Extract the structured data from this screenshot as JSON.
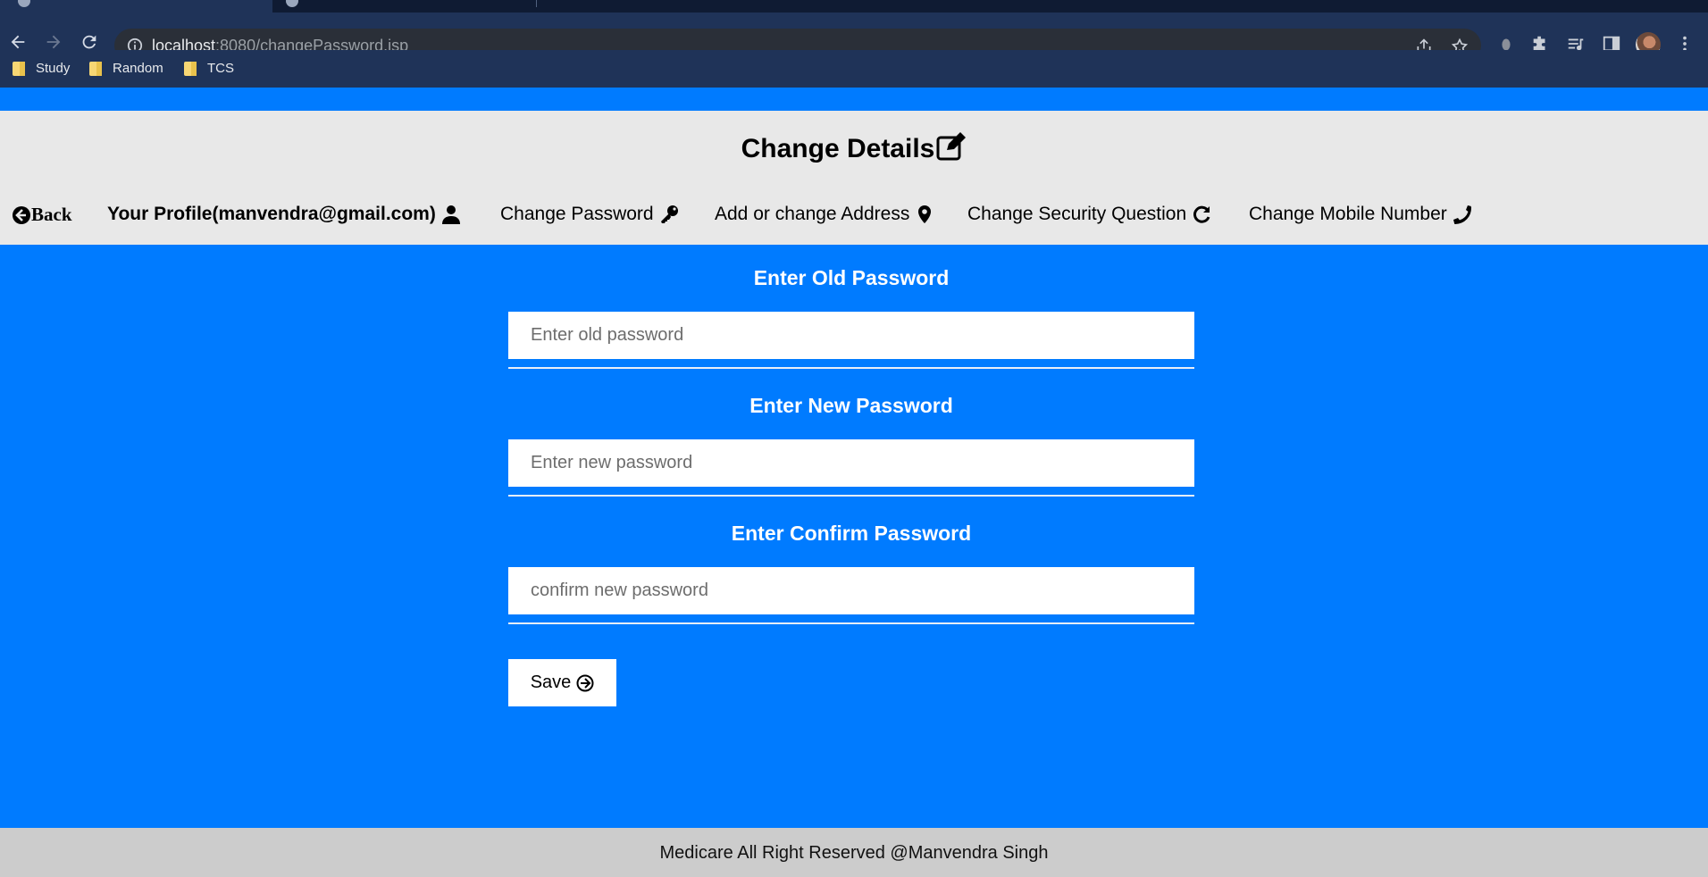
{
  "browser": {
    "url_host": "localhost",
    "url_rest": ":8080/changePassword.jsp",
    "bookmarks": [
      {
        "label": "Study"
      },
      {
        "label": "Random"
      },
      {
        "label": "TCS"
      }
    ]
  },
  "header": {
    "title": "Change Details",
    "nav": {
      "back": "Back",
      "profile": "Your Profile(manvendra@gmail.com)",
      "change_password": "Change Password",
      "address": "Add or change Address",
      "security": "Change Security Question",
      "mobile": "Change Mobile Number"
    }
  },
  "form": {
    "old_label": "Enter Old Password",
    "old_placeholder": "Enter old password",
    "new_label": "Enter New Password",
    "new_placeholder": "Enter new password",
    "confirm_label": "Enter Confirm Password",
    "confirm_placeholder": "confirm new password",
    "save_label": "Save"
  },
  "footer": {
    "text": "Medicare All Right Reserved @Manvendra Singh"
  },
  "colors": {
    "page_bg": "#007bff",
    "header_bg": "#e8e8e8",
    "footer_bg": "#cccccc",
    "browser_bg": "#1f3358"
  }
}
